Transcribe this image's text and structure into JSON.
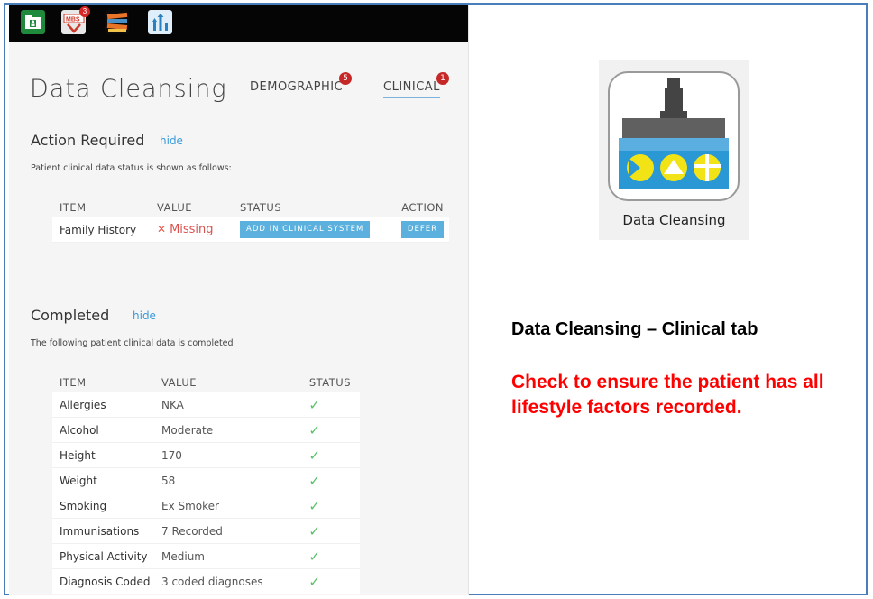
{
  "toolbar": {
    "icons": [
      "contact-card-icon",
      "mbs-icon",
      "books-icon",
      "chart-arrows-icon"
    ],
    "mbs_label": "MBS",
    "mbs_badge": "3"
  },
  "page": {
    "title": "Data Cleansing",
    "tabs": [
      {
        "label": "DEMOGRAPHIC",
        "badge": "5"
      },
      {
        "label": "CLINICAL",
        "badge": "1"
      }
    ]
  },
  "action_required": {
    "title": "Action Required",
    "hide": "hide",
    "note": "Patient clinical data status is shown as follows:",
    "headers": [
      "ITEM",
      "VALUE",
      "STATUS",
      "ACTION"
    ],
    "rows": [
      {
        "item": "Family History",
        "value": "Missing",
        "status_button": "ADD IN CLINICAL SYSTEM",
        "action_button": "DEFER"
      }
    ]
  },
  "completed": {
    "title": "Completed",
    "hide": "hide",
    "note": "The following patient clinical data is completed",
    "headers": [
      "ITEM",
      "VALUE",
      "STATUS"
    ],
    "rows": [
      {
        "item": "Allergies",
        "value": "NKA"
      },
      {
        "item": "Alcohol",
        "value": "Moderate"
      },
      {
        "item": "Height",
        "value": "170"
      },
      {
        "item": "Weight",
        "value": "58"
      },
      {
        "item": "Smoking",
        "value": "Ex Smoker"
      },
      {
        "item": "Immunisations",
        "value": "7 Recorded"
      },
      {
        "item": "Physical Activity",
        "value": "Medium"
      },
      {
        "item": "Diagnosis Coded",
        "value": "3 coded diagnoses"
      }
    ]
  },
  "sidebar_logo": {
    "label": "Data Cleansing",
    "icon": "data-cleansing-icon"
  },
  "annotation": {
    "heading": "Data Cleansing – Clinical tab",
    "instruction": "Check to ensure the patient has all lifestyle factors recorded."
  },
  "colors": {
    "accent": "#3a9ad9",
    "button": "#5bb0dd",
    "missing": "#d9534f",
    "check": "#5cc06a",
    "instruction": "#ff0000"
  }
}
